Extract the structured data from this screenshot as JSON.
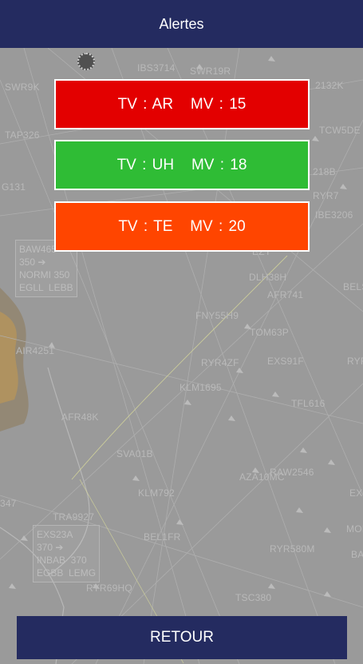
{
  "header": {
    "title": "Alertes"
  },
  "alerts": [
    {
      "text": "TV : AR   MV : 15",
      "color": "#e30000"
    },
    {
      "text": "TV : UH   MV : 18",
      "color": "#2fbc35"
    },
    {
      "text": "TV : TE   MV : 20",
      "color": "#ff4500"
    }
  ],
  "map": {
    "callsigns": [
      "IBS3714",
      "SWR19R",
      "SWR9K",
      "TAP326",
      "G131",
      "TCW5DE",
      "IBE3206",
      "RYR7",
      "EZY",
      "DLH38H",
      "AFR741",
      "BELS",
      "FNY55H9",
      "TOM63P",
      "RYR4ZF",
      "EXS91F",
      "RYR",
      "KLM1695",
      "TFL616",
      "AFR48K",
      "SVA01B",
      "AZA10MC",
      "RAW2546",
      "KLM792",
      "BEL1FR",
      "RYR580M",
      "TRA9927",
      "RYR69HQ",
      "TSC380",
      "AIR4251",
      "347",
      "MOI",
      "BA",
      "EX",
      "2132K",
      "218B"
    ],
    "datablocks": [
      "BAW465\n350 ➔\nNORMI 350\nEGLL  LEBB",
      "EXS23A\n370 ➔\nINBAB  370\nEGBB  LEMG"
    ]
  },
  "footer": {
    "back_label": "RETOUR"
  }
}
